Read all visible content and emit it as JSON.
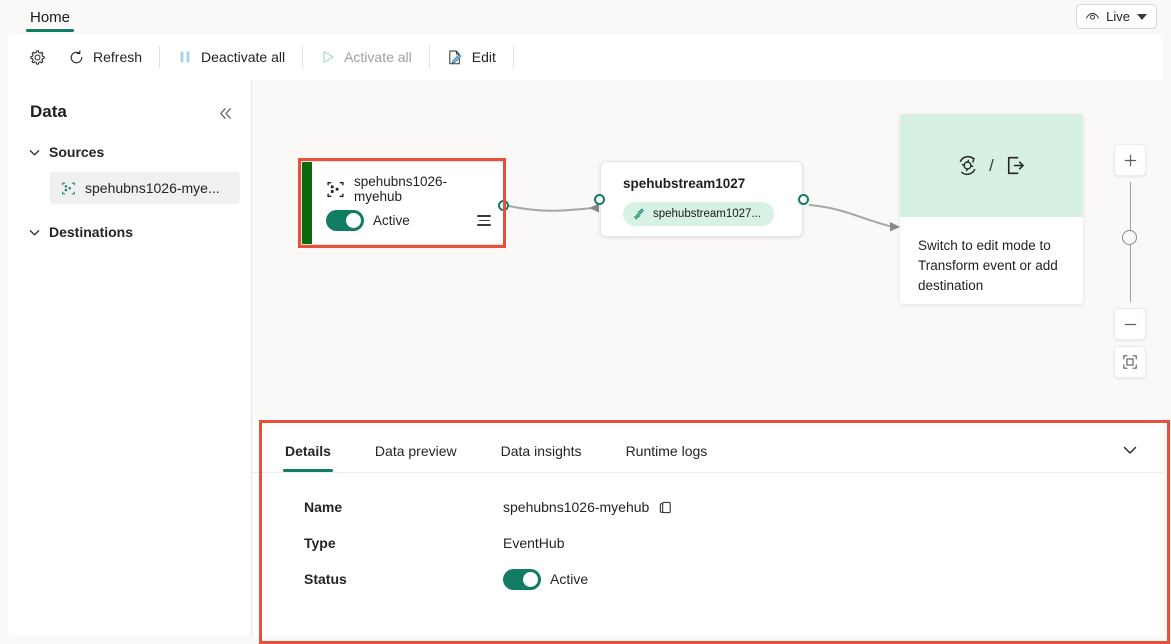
{
  "tabstrip": {
    "home_tab": "Home",
    "live_label": "Live"
  },
  "toolbar": {
    "settings_icon": "gear-icon",
    "refresh_label": "Refresh",
    "deactivate_all_label": "Deactivate all",
    "activate_all_label": "Activate all",
    "edit_label": "Edit"
  },
  "sidebar": {
    "title": "Data",
    "collapse_icon": "double-chevron-left-icon",
    "groups": [
      {
        "label": "Sources",
        "expanded": true
      },
      {
        "label": "Destinations",
        "expanded": true
      }
    ],
    "source_item": "spehubns1026-mye..."
  },
  "canvas": {
    "source_node": {
      "title": "spehubns1026-myehub",
      "status_label": "Active",
      "status_on": true,
      "icon": "eventhub-icon",
      "menu_icon": "hamburger-icon",
      "accent_color": "#0b6a0b"
    },
    "stream_node": {
      "title": "spehubstream1027",
      "pill_label": "spehubstream1027...",
      "pill_icon": "eventstream-icon"
    },
    "hint_node": {
      "icon_left": "transform-icon",
      "separator": "/",
      "icon_right": "export-destination-icon",
      "text": "Switch to edit mode to Transform event or add destination"
    },
    "zoom_controls": {
      "zoom_in_icon": "plus-icon",
      "zoom_out_icon": "minus-icon",
      "fit_icon": "fit-to-screen-icon"
    }
  },
  "bottom_panel": {
    "tabs": [
      {
        "label": "Details",
        "active": true
      },
      {
        "label": "Data preview",
        "active": false
      },
      {
        "label": "Data insights",
        "active": false
      },
      {
        "label": "Runtime logs",
        "active": false
      }
    ],
    "collapse_icon": "chevron-down-icon",
    "details": {
      "name_label": "Name",
      "name_value": "spehubns1026-myehub",
      "copy_icon": "copy-icon",
      "type_label": "Type",
      "type_value": "EventHub",
      "status_label": "Status",
      "status_value": "Active",
      "status_on": true
    }
  },
  "colors": {
    "accent_green": "#107c61",
    "node_accent": "#0b6a0b",
    "annotation_red": "#e8503a",
    "pill_green": "#d7f2e3"
  }
}
